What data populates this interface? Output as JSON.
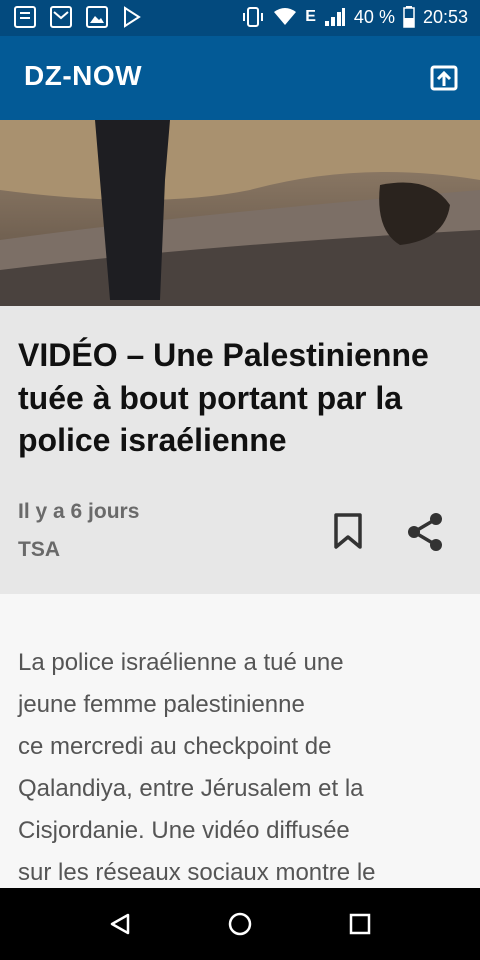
{
  "status_bar": {
    "signal": "E",
    "battery_percent": "40 %",
    "time": "20:53",
    "left_icons": [
      "newspaper-icon",
      "gmail-icon",
      "photos-icon",
      "play-store-icon"
    ],
    "right_icons": [
      "vibrate-icon",
      "wifi-icon",
      "signal-icon",
      "battery-icon"
    ]
  },
  "app_bar": {
    "title": "DZ-NOW",
    "action_icon": "open-share-icon"
  },
  "article": {
    "headline": "VIDÉO – Une Palestinienne tuée à bout portant par la police israélienne",
    "time_ago": "Il y a 6 jours",
    "source": "TSA",
    "body": "La police israélienne a tué une\njeune femme palestinienne\nce mercredi au checkpoint de\nQalandiya, entre Jérusalem et la\nCisjordanie. Une vidéo diffusée\nsur les réseaux sociaux montre le",
    "actions": [
      "bookmark-icon",
      "share-icon"
    ]
  },
  "colors": {
    "status_bar": "#034a7e",
    "app_bar": "#035a96",
    "card_bg": "#e7e7e7",
    "page_bg": "#f7f7f7",
    "meta_text": "#6a6a6a"
  }
}
